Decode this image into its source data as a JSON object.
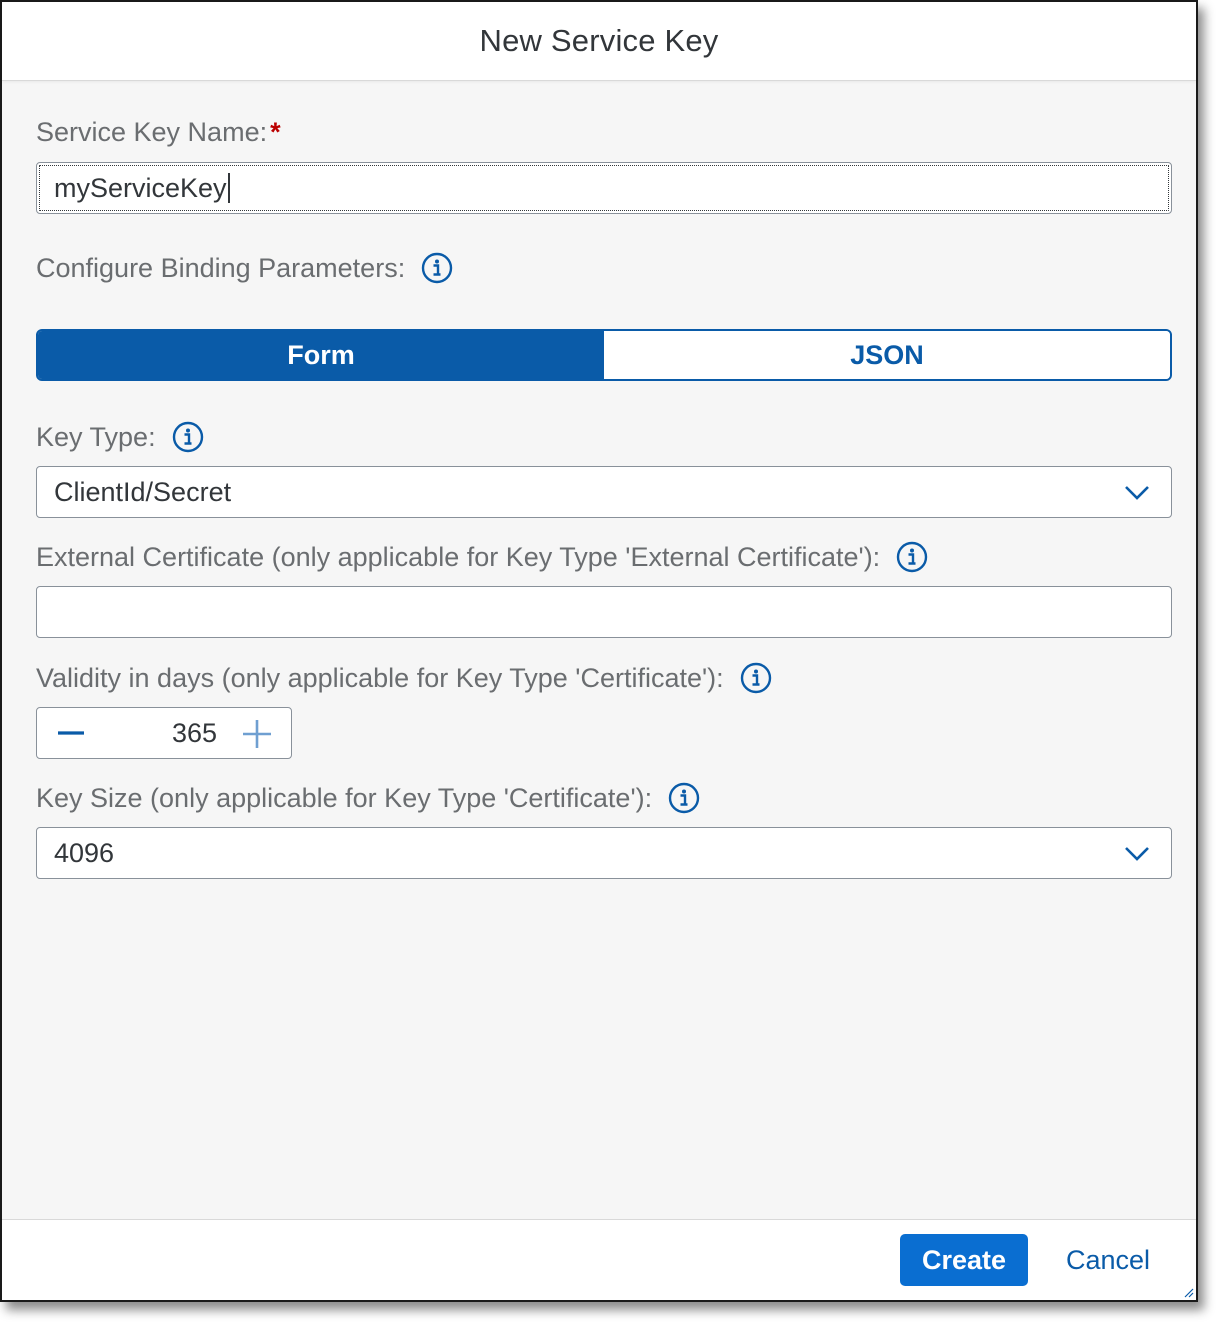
{
  "dialog": {
    "title": "New Service Key"
  },
  "service_key_name": {
    "label": "Service Key Name:",
    "required_marker": "*",
    "value": "myServiceKey"
  },
  "binding_params": {
    "label": "Configure Binding Parameters:",
    "tabs": [
      {
        "label": "Form",
        "active": true
      },
      {
        "label": "JSON",
        "active": false
      }
    ]
  },
  "key_type": {
    "label": "Key Type:",
    "selected": "ClientId/Secret"
  },
  "external_certificate": {
    "label": "External Certificate (only applicable for Key Type 'External Certificate'):",
    "value": ""
  },
  "validity": {
    "label": "Validity in days (only applicable for Key Type 'Certificate'):",
    "value": "365"
  },
  "key_size": {
    "label": "Key Size (only applicable for Key Type 'Certificate'):",
    "selected": "4096"
  },
  "footer": {
    "create_label": "Create",
    "cancel_label": "Cancel"
  },
  "colors": {
    "accent": "#0a5ba8",
    "primary_button": "#0a6ed1",
    "required": "#bb0000",
    "background": "#f6f6f6"
  },
  "icons": [
    "info-icon",
    "chevron-down-icon",
    "minus-icon",
    "plus-icon",
    "resize-handle-icon"
  ]
}
